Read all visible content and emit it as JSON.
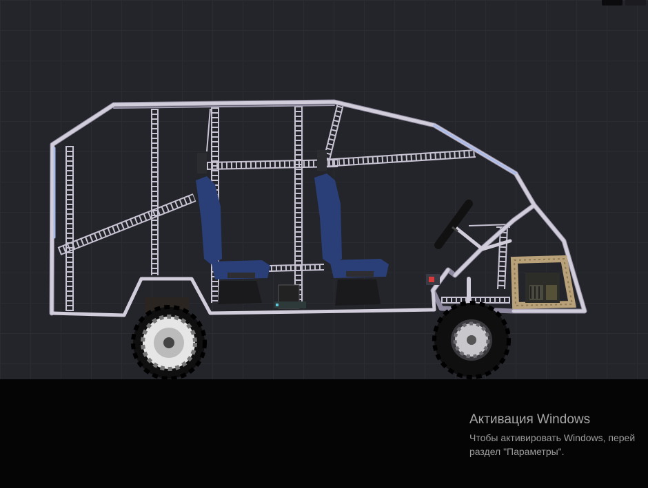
{
  "watermark": {
    "title": "Активация Windows",
    "line1": "Чтобы активировать Windows, перей",
    "line2": "раздел \"Параметры\"."
  },
  "scene": {
    "vehicle": "custom buggy with roll-cage frame",
    "parts": [
      "steel-frame",
      "ladder-brace",
      "blue-seat",
      "steering-wheel",
      "wheel",
      "crate",
      "generator",
      "engine-part"
    ]
  },
  "colors": {
    "background": "#24252a",
    "frame": "#cfcad8",
    "frame-shade": "#9d98ad",
    "seat": "#2a3f78",
    "tire": "#111111",
    "crate": "#b9a27a",
    "ground": "#050506"
  }
}
